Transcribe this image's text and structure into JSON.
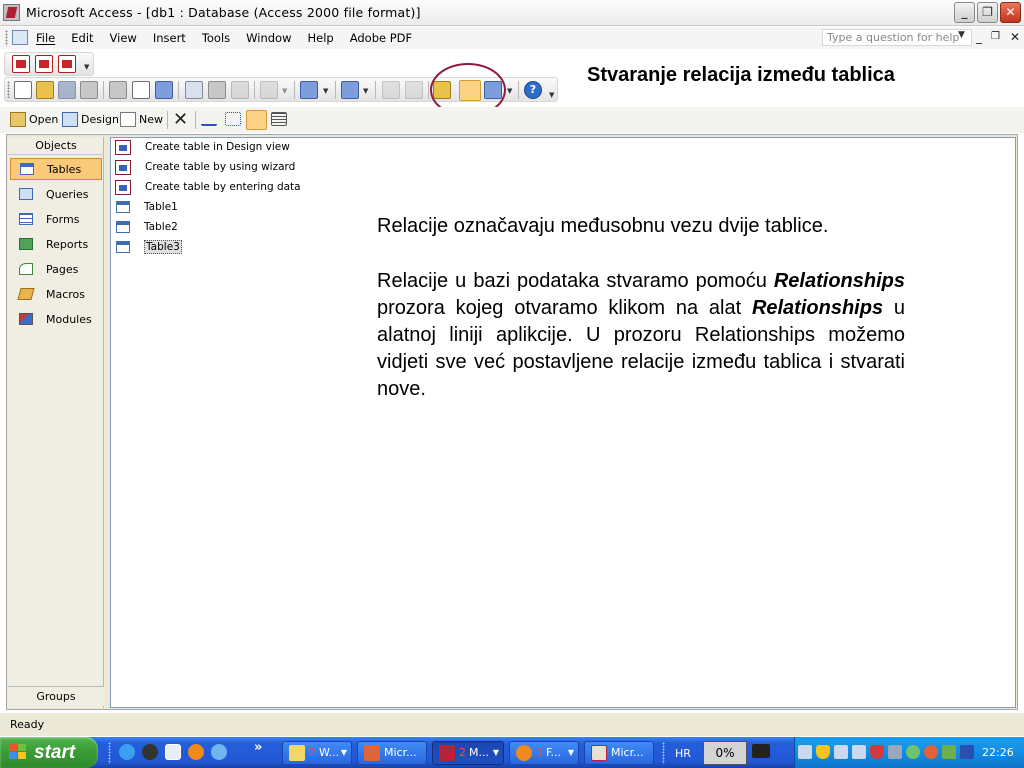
{
  "window": {
    "title": "Microsoft Access - [db1 : Database (Access 2000 file format)]",
    "minimize": "_",
    "restore": "❐",
    "close": "✕"
  },
  "menu": {
    "items": [
      "File",
      "Edit",
      "View",
      "Insert",
      "Tools",
      "Window",
      "Help",
      "Adobe PDF"
    ],
    "help_placeholder": "Type a question for help",
    "mdi_minimize": "_",
    "mdi_restore": "❐",
    "mdi_close": "✕"
  },
  "slide": {
    "title": "Stvaranje relacija između tablica",
    "paragraph1": "Relacije označavaju međusobnu vezu dvije tablice.",
    "paragraph2_a": "Relacije u bazi podataka stvaramo pomoću ",
    "paragraph2_em1": "Relationships",
    "paragraph2_b": " prozora kojeg otvaramo klikom na alat ",
    "paragraph2_em2": "Relationships",
    "paragraph2_c": " u alatnoj liniji aplikcije. U prozoru Relationships možemo vidjeti sve već postavljene relacije između tablica i stvarati nove."
  },
  "db_toolbar": {
    "open": "Open",
    "design": "Design",
    "new": "New"
  },
  "objects": {
    "header": "Objects",
    "items": [
      "Tables",
      "Queries",
      "Forms",
      "Reports",
      "Pages",
      "Macros",
      "Modules"
    ],
    "active": "Tables",
    "groups": "Groups"
  },
  "list": {
    "items": [
      "Create table in Design view",
      "Create table by using wizard",
      "Create table by entering data",
      "Table1",
      "Table2",
      "Table3"
    ],
    "selected": "Table3"
  },
  "status": {
    "text": "Ready"
  },
  "taskbar": {
    "start": "start",
    "chevron": "»",
    "buttons": [
      {
        "num": "2",
        "label": "W..."
      },
      {
        "num": "",
        "label": "Micr..."
      },
      {
        "num": "2",
        "label": "M..."
      },
      {
        "num": "3",
        "label": "F..."
      },
      {
        "num": "",
        "label": "Micr..."
      }
    ],
    "language": "HR",
    "percent": "0%",
    "clock": "22:26"
  },
  "colors": {
    "active_object": "#fbc97a",
    "highlight_ring": "#8e1c3c",
    "taskbar": "#245edb",
    "start_button": "#3a9a35"
  }
}
